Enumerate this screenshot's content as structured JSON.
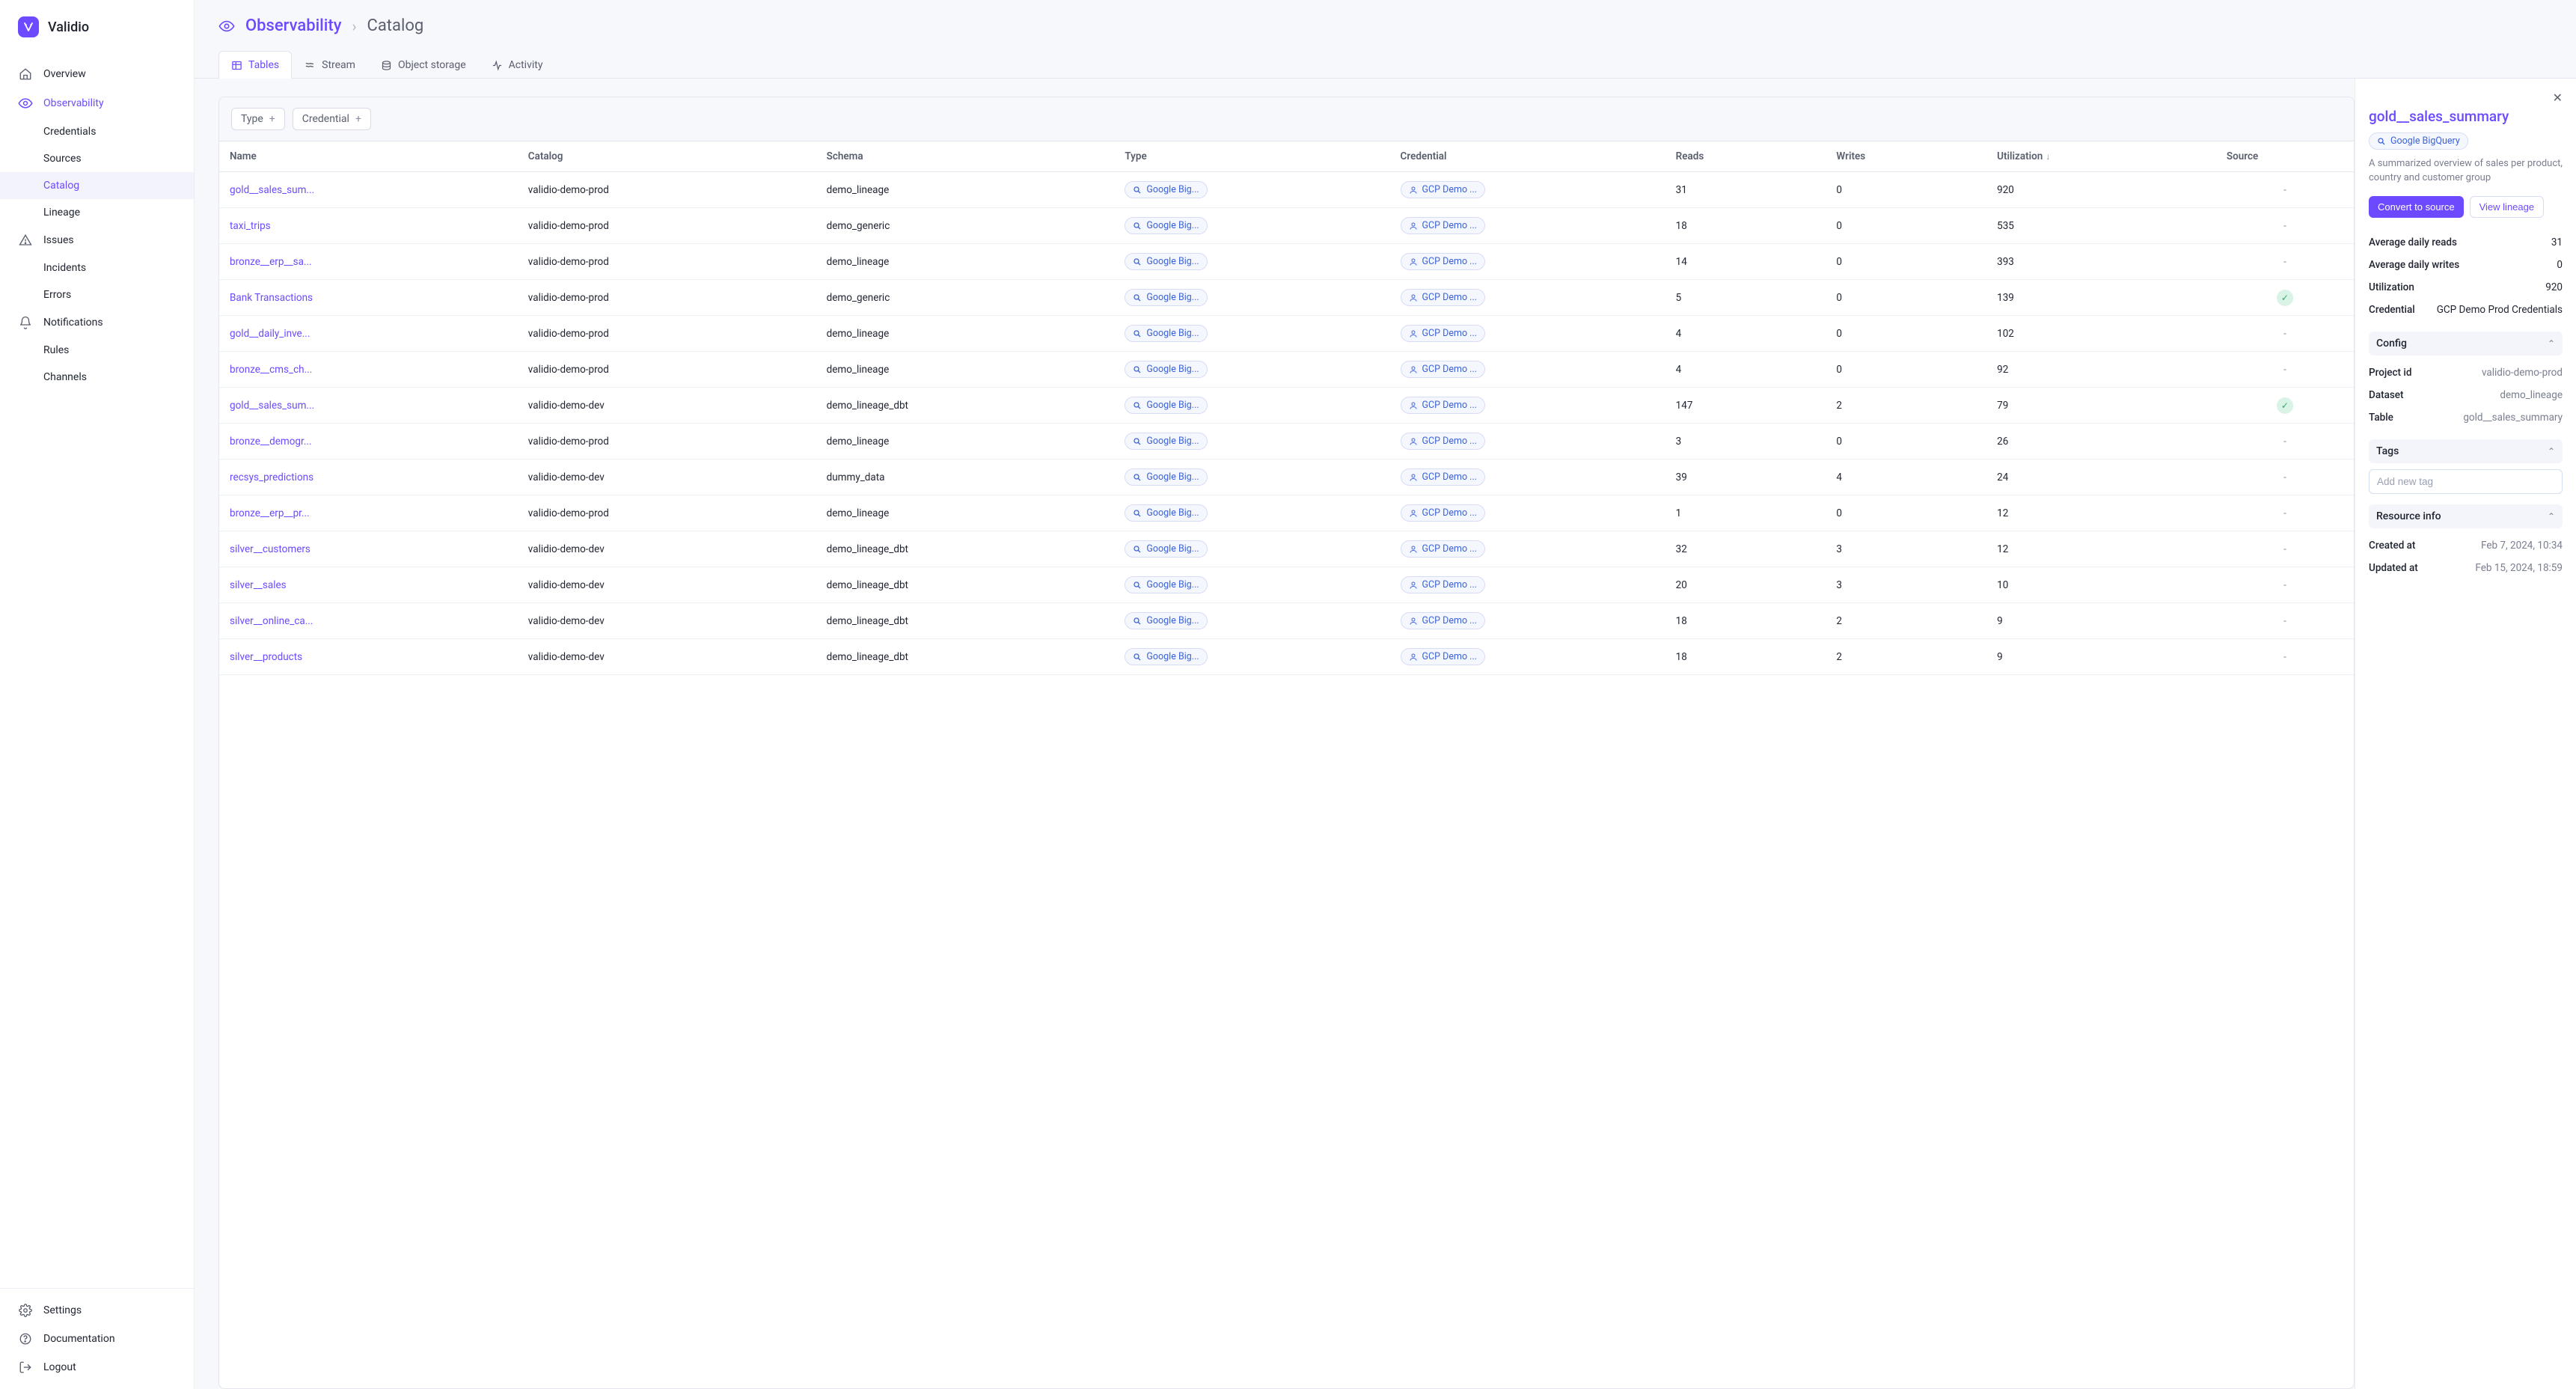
{
  "brand": {
    "name": "Validio"
  },
  "sidebar": {
    "primary": [
      {
        "label": "Overview",
        "icon": "home"
      },
      {
        "label": "Observability",
        "icon": "eye",
        "active": true,
        "children": [
          {
            "label": "Credentials"
          },
          {
            "label": "Sources"
          },
          {
            "label": "Catalog",
            "active": true
          },
          {
            "label": "Lineage"
          }
        ]
      },
      {
        "label": "Issues",
        "icon": "alert",
        "children": [
          {
            "label": "Incidents"
          },
          {
            "label": "Errors"
          }
        ]
      },
      {
        "label": "Notifications",
        "icon": "bell",
        "children": [
          {
            "label": "Rules"
          },
          {
            "label": "Channels"
          }
        ]
      }
    ],
    "footer": [
      {
        "label": "Settings",
        "icon": "gear"
      },
      {
        "label": "Documentation",
        "icon": "help"
      },
      {
        "label": "Logout",
        "icon": "logout"
      }
    ]
  },
  "breadcrumb": {
    "root": "Observability",
    "current": "Catalog"
  },
  "tabs": [
    {
      "label": "Tables",
      "icon": "table",
      "active": true
    },
    {
      "label": "Stream",
      "icon": "stream"
    },
    {
      "label": "Object storage",
      "icon": "storage"
    },
    {
      "label": "Activity",
      "icon": "activity"
    }
  ],
  "filters": [
    {
      "label": "Type"
    },
    {
      "label": "Credential"
    }
  ],
  "columns": {
    "name": "Name",
    "catalog": "Catalog",
    "schema": "Schema",
    "type": "Type",
    "credential": "Credential",
    "reads": "Reads",
    "writes": "Writes",
    "utilization": "Utilization",
    "source": "Source"
  },
  "type_pill_label": "Google Big...",
  "cred_pill_label": "GCP Demo ...",
  "rows": [
    {
      "name": "gold__sales_sum...",
      "catalog": "validio-demo-prod",
      "schema": "demo_lineage",
      "reads": "31",
      "writes": "0",
      "util": "920",
      "source": "-"
    },
    {
      "name": "taxi_trips",
      "catalog": "validio-demo-prod",
      "schema": "demo_generic",
      "reads": "18",
      "writes": "0",
      "util": "535",
      "source": "-"
    },
    {
      "name": "bronze__erp__sa...",
      "catalog": "validio-demo-prod",
      "schema": "demo_lineage",
      "reads": "14",
      "writes": "0",
      "util": "393",
      "source": "-"
    },
    {
      "name": "Bank Transactions",
      "catalog": "validio-demo-prod",
      "schema": "demo_generic",
      "reads": "5",
      "writes": "0",
      "util": "139",
      "source": "check"
    },
    {
      "name": "gold__daily_inve...",
      "catalog": "validio-demo-prod",
      "schema": "demo_lineage",
      "reads": "4",
      "writes": "0",
      "util": "102",
      "source": "-"
    },
    {
      "name": "bronze__cms_ch...",
      "catalog": "validio-demo-prod",
      "schema": "demo_lineage",
      "reads": "4",
      "writes": "0",
      "util": "92",
      "source": "-"
    },
    {
      "name": "gold__sales_sum...",
      "catalog": "validio-demo-dev",
      "schema": "demo_lineage_dbt",
      "reads": "147",
      "writes": "2",
      "util": "79",
      "source": "check"
    },
    {
      "name": "bronze__demogr...",
      "catalog": "validio-demo-prod",
      "schema": "demo_lineage",
      "reads": "3",
      "writes": "0",
      "util": "26",
      "source": "-"
    },
    {
      "name": "recsys_predictions",
      "catalog": "validio-demo-dev",
      "schema": "dummy_data",
      "reads": "39",
      "writes": "4",
      "util": "24",
      "source": "-"
    },
    {
      "name": "bronze__erp__pr...",
      "catalog": "validio-demo-prod",
      "schema": "demo_lineage",
      "reads": "1",
      "writes": "0",
      "util": "12",
      "source": "-"
    },
    {
      "name": "silver__customers",
      "catalog": "validio-demo-dev",
      "schema": "demo_lineage_dbt",
      "reads": "32",
      "writes": "3",
      "util": "12",
      "source": "-"
    },
    {
      "name": "silver__sales",
      "catalog": "validio-demo-dev",
      "schema": "demo_lineage_dbt",
      "reads": "20",
      "writes": "3",
      "util": "10",
      "source": "-"
    },
    {
      "name": "silver__online_ca...",
      "catalog": "validio-demo-dev",
      "schema": "demo_lineage_dbt",
      "reads": "18",
      "writes": "2",
      "util": "9",
      "source": "-"
    },
    {
      "name": "silver__products",
      "catalog": "validio-demo-dev",
      "schema": "demo_lineage_dbt",
      "reads": "18",
      "writes": "2",
      "util": "9",
      "source": "-"
    }
  ],
  "details": {
    "title": "gold__sales_summary",
    "type_label": "Google BigQuery",
    "description": "A summarized overview of sales per product, country and customer group",
    "convert_label": "Convert to source",
    "view_lineage_label": "View lineage",
    "stats": [
      {
        "label": "Average daily reads",
        "value": "31"
      },
      {
        "label": "Average daily writes",
        "value": "0"
      },
      {
        "label": "Utilization",
        "value": "920"
      },
      {
        "label": "Credential",
        "value": "GCP Demo Prod Credentials"
      }
    ],
    "config_header": "Config",
    "config": [
      {
        "label": "Project id",
        "value": "validio-demo-prod"
      },
      {
        "label": "Dataset",
        "value": "demo_lineage"
      },
      {
        "label": "Table",
        "value": "gold__sales_summary"
      }
    ],
    "tags_header": "Tags",
    "tag_placeholder": "Add new tag",
    "resource_header": "Resource info",
    "resource": [
      {
        "label": "Created at",
        "value": "Feb 7, 2024, 10:34"
      },
      {
        "label": "Updated at",
        "value": "Feb 15, 2024, 18:59"
      }
    ]
  }
}
